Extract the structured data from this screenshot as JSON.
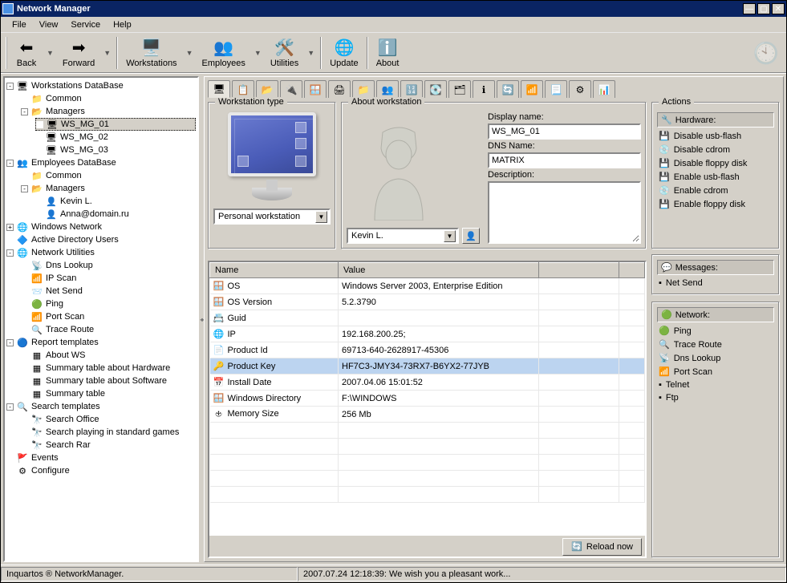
{
  "title": "Network Manager",
  "menu": [
    "File",
    "View",
    "Service",
    "Help"
  ],
  "toolbar": {
    "back": "Back",
    "forward": "Forward",
    "workstations": "Workstations",
    "employees": "Employees",
    "utilities": "Utilities",
    "update": "Update",
    "about": "About"
  },
  "tree": {
    "workstations_db": "Workstations DataBase",
    "common": "Common",
    "managers": "Managers",
    "ws1": "WS_MG_01",
    "ws2": "WS_MG_02",
    "ws3": "WS_MG_03",
    "employees_db": "Employees DataBase",
    "kevin": "Kevin L.",
    "anna": "Anna@domain.ru",
    "windows_network": "Windows Network",
    "ad_users": "Active Directory Users",
    "net_utils": "Network Utilities",
    "dns_lookup": "Dns Lookup",
    "ip_scan": "IP Scan",
    "net_send": "Net Send",
    "ping": "Ping",
    "port_scan": "Port Scan",
    "trace_route": "Trace Route",
    "report_tpl": "Report templates",
    "about_ws": "About WS",
    "sum_hw": "Summary table about Hardware",
    "sum_sw": "Summary table about Software",
    "sum_tbl": "Summary table",
    "search_tpl": "Search templates",
    "search_office": "Search Office",
    "search_games": "Search playing in standard games",
    "search_rar": "Search Rar",
    "events": "Events",
    "configure": "Configure"
  },
  "tabs_count": 17,
  "ws_type": {
    "legend": "Workstation type",
    "selected": "Personal workstation"
  },
  "about_ws_box": {
    "legend": "About workstation",
    "display_name_label": "Display name:",
    "display_name": "WS_MG_01",
    "dns_label": "DNS Name:",
    "dns": "MATRIX",
    "desc_label": "Description:",
    "user_selected": "Kevin L."
  },
  "actions": {
    "legend": "Actions",
    "hardware": "Hardware:",
    "disable_usb": "Disable usb-flash",
    "disable_cd": "Disable cdrom",
    "disable_floppy": "Disable floppy disk",
    "enable_usb": "Enable usb-flash",
    "enable_cd": "Enable cdrom",
    "enable_floppy": "Enable floppy disk",
    "messages": "Messages:",
    "net_send": "Net Send",
    "network": "Network:",
    "ping": "Ping",
    "trace": "Trace Route",
    "dns": "Dns Lookup",
    "port_scan": "Port Scan",
    "telnet": "Telnet",
    "ftp": "Ftp"
  },
  "table": {
    "headers": {
      "name": "Name",
      "value": "Value"
    },
    "rows": [
      {
        "icon": "🪟",
        "name": "OS",
        "value": "Windows Server 2003, Enterprise Edition"
      },
      {
        "icon": "🪟",
        "name": "OS Version",
        "value": "5.2.3790"
      },
      {
        "icon": "📇",
        "name": "Guid",
        "value": ""
      },
      {
        "icon": "🌐",
        "name": "IP",
        "value": "192.168.200.25;"
      },
      {
        "icon": "📄",
        "name": "Product Id",
        "value": "69713-640-2628917-45306"
      },
      {
        "icon": "🔑",
        "name": "Product Key",
        "value": "HF7C3-JMY34-73RX7-B6YX2-77JYB",
        "selected": true
      },
      {
        "icon": "📅",
        "name": "Install Date",
        "value": "2007.04.06  15:01:52"
      },
      {
        "icon": "🪟",
        "name": "Windows Directory",
        "value": "F:\\WINDOWS"
      },
      {
        "icon": "🕁",
        "name": "Memory Size",
        "value": "256 Mb"
      }
    ],
    "reload": "Reload now"
  },
  "status": {
    "left": "Inquartos ® NetworkManager.",
    "right": "2007.07.24 12:18:39: We wish you a pleasant work..."
  }
}
